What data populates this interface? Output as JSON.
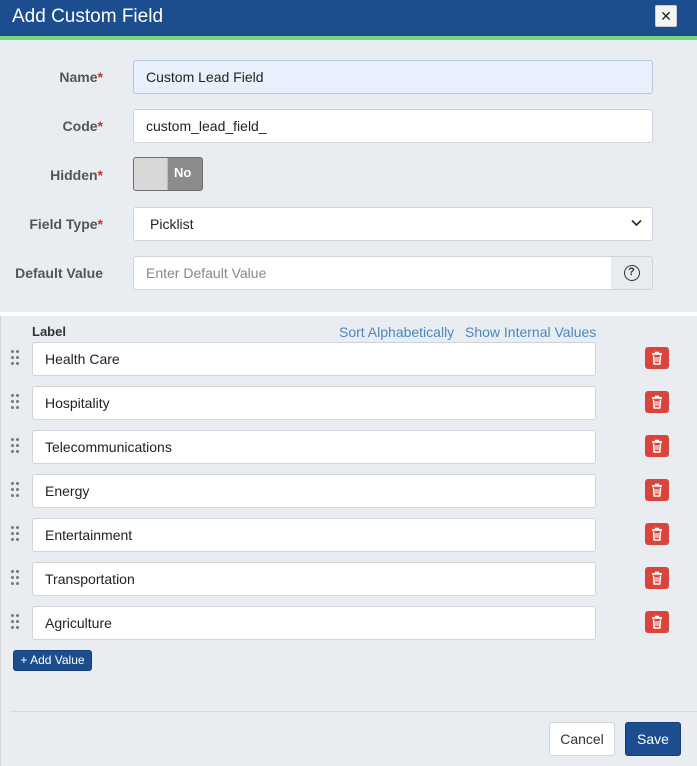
{
  "dialog": {
    "title": "Add Custom Field",
    "close_symbol": "✕"
  },
  "form": {
    "required_mark": "*",
    "name": {
      "label": "Name",
      "value": "Custom Lead Field"
    },
    "code": {
      "label": "Code",
      "value": "custom_lead_field_"
    },
    "hidden": {
      "label": "Hidden",
      "toggle_text": "No"
    },
    "field_type": {
      "label": "Field Type",
      "value": "Picklist"
    },
    "default_value": {
      "label": "Default Value",
      "placeholder": "Enter Default Value",
      "help_symbol": "?"
    }
  },
  "values": {
    "column_label": "Label",
    "sort_link": "Sort Alphabetically",
    "show_internal_link": "Show Internal Values",
    "items": [
      {
        "label": "Health Care"
      },
      {
        "label": "Hospitality"
      },
      {
        "label": "Telecommunications"
      },
      {
        "label": "Energy"
      },
      {
        "label": "Entertainment"
      },
      {
        "label": "Transportation"
      },
      {
        "label": "Agriculture"
      }
    ],
    "add_button": "+ Add Value"
  },
  "footer": {
    "cancel": "Cancel",
    "save": "Save"
  },
  "colors": {
    "header": "#1c4e8f",
    "accent": "#7bd67b",
    "delete": "#d9453c",
    "required": "#c0392b",
    "link": "#4a88c2"
  }
}
